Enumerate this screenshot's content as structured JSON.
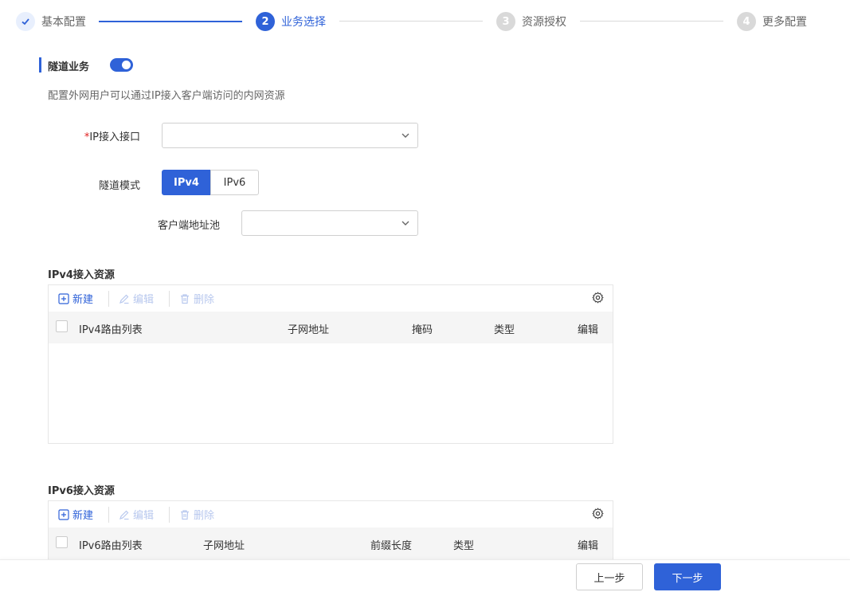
{
  "stepper": {
    "steps": [
      {
        "num": "✓",
        "label": "基本配置"
      },
      {
        "num": "2",
        "label": "业务选择"
      },
      {
        "num": "3",
        "label": "资源授权"
      },
      {
        "num": "4",
        "label": "更多配置"
      }
    ]
  },
  "section": {
    "title": "隧道业务",
    "toggle_on": true,
    "description": "配置外网用户可以通过IP接入客户端访问的内网资源"
  },
  "form": {
    "ip_interface": {
      "required_mark": "*",
      "label": "IP接入接口",
      "value": ""
    },
    "tunnel_mode": {
      "label": "隧道模式",
      "options": [
        "IPv4",
        "IPv6"
      ],
      "selected": "IPv4"
    },
    "client_pool": {
      "label": "客户端地址池",
      "value": ""
    }
  },
  "ipv4_table": {
    "title": "IPv4接入资源",
    "toolbar": {
      "new": "新建",
      "edit": "编辑",
      "delete": "删除"
    },
    "columns": [
      "IPv4路由列表",
      "子网地址",
      "掩码",
      "类型",
      "编辑"
    ],
    "rows": []
  },
  "ipv6_table": {
    "title": "IPv6接入资源",
    "toolbar": {
      "new": "新建",
      "edit": "编辑",
      "delete": "删除"
    },
    "columns": [
      "IPv6路由列表",
      "子网地址",
      "前缀长度",
      "类型",
      "编辑"
    ],
    "rows": []
  },
  "footer": {
    "prev": "上一步",
    "next": "下一步"
  },
  "colors": {
    "accent": "#2f62d8",
    "required": "#e02020"
  }
}
